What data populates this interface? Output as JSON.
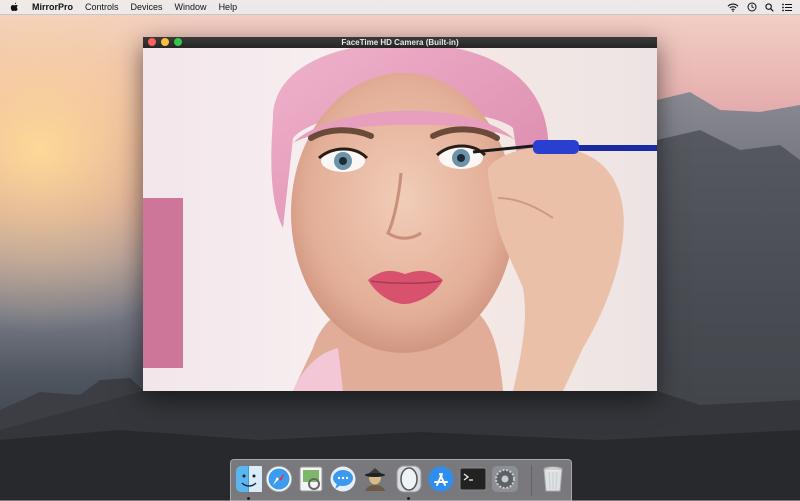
{
  "menubar": {
    "apple_icon": "apple-icon",
    "app_name": "MirrorPro",
    "menus": [
      "Controls",
      "Devices",
      "Window",
      "Help"
    ],
    "status_icons": [
      "wifi-icon",
      "clock-icon",
      "spotlight-search-icon",
      "notification-center-icon"
    ]
  },
  "window": {
    "title": "FaceTime HD Camera (Built-in)"
  },
  "dock": {
    "items": [
      {
        "name": "finder-icon",
        "running": true
      },
      {
        "name": "safari-icon",
        "running": false
      },
      {
        "name": "preview-icon",
        "running": false
      },
      {
        "name": "messages-icon",
        "running": false
      },
      {
        "name": "alfred-icon",
        "running": false
      },
      {
        "name": "mirrorpro-icon",
        "running": true
      },
      {
        "name": "app-store-icon",
        "running": false
      },
      {
        "name": "terminal-icon",
        "running": false
      },
      {
        "name": "system-preferences-icon",
        "running": false
      },
      {
        "name": "trash-icon",
        "running": false
      }
    ]
  },
  "colors": {
    "close": "#fc605c",
    "minimize": "#fdbc40",
    "maximize": "#34c84a"
  }
}
